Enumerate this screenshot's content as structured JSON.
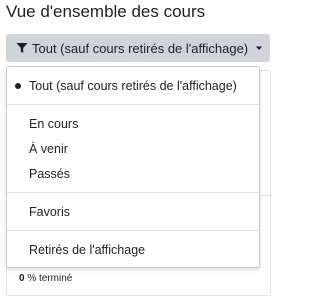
{
  "heading": "Vue d'ensemble des cours",
  "filter": {
    "button_label": "Tout (sauf cours retirés de l'affichage)",
    "icon": "funnel-icon",
    "caret_icon": "caret-down-icon"
  },
  "menu": {
    "items": [
      {
        "label": "Tout (sauf cours retirés de l'affichage)",
        "selected": true
      },
      {
        "label": "En cours",
        "selected": false
      },
      {
        "label": "À venir",
        "selected": false
      },
      {
        "label": "Passés",
        "selected": false
      },
      {
        "label": "Favoris",
        "selected": false
      },
      {
        "label": "Retirés de l'affichage",
        "selected": false
      }
    ]
  },
  "course_card": {
    "progress_value": "0",
    "progress_suffix": "% terminé"
  },
  "colors": {
    "button_bg": "#ced4da",
    "text": "#1d2125",
    "border": "#dee2e6"
  }
}
